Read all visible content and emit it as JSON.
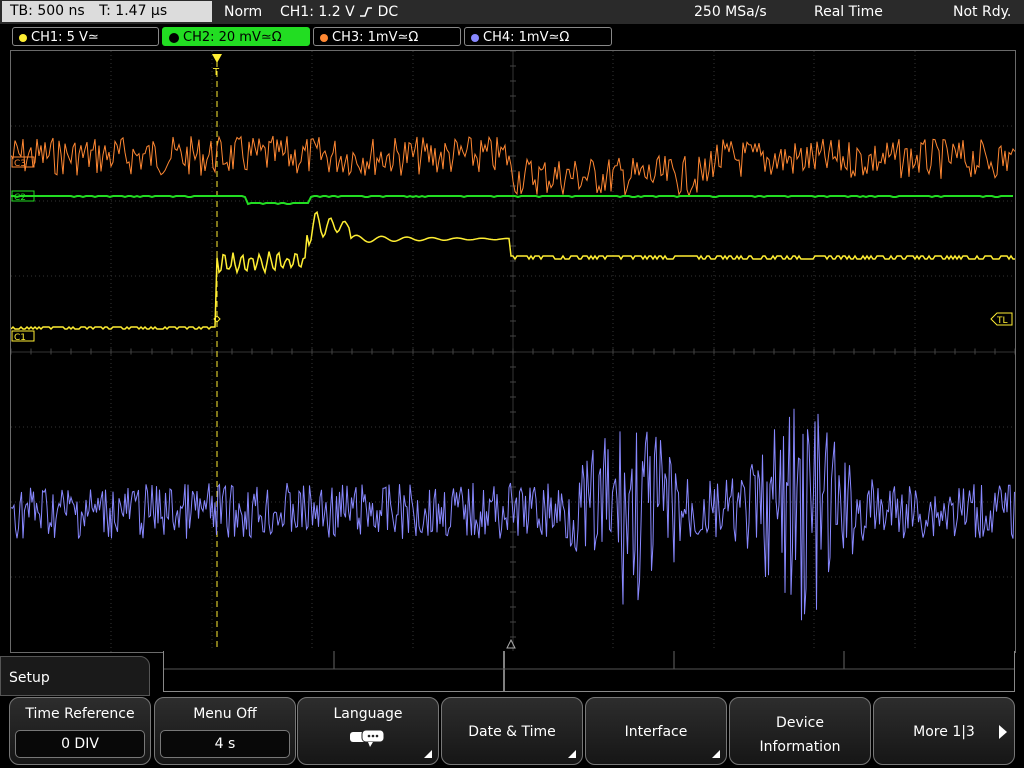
{
  "status": {
    "timebase": "TB: 500 ns",
    "trigger_time": "T: 1.47 µs",
    "mode": "Norm",
    "trigger_source": "CH1: 1.2 V",
    "trigger_coupling": "DC",
    "sample_rate": "250 MSa/s",
    "acquisition": "Real Time",
    "state": "Not Rdy."
  },
  "channels": [
    {
      "label": "CH1: 5 V≃",
      "color": "#ffee33"
    },
    {
      "label": "CH2: 20 mV≃Ω",
      "color": "#22dd22"
    },
    {
      "label": "CH3: 1mV≃Ω",
      "color": "#ff8833"
    },
    {
      "label": "CH4: 1mV≃Ω",
      "color": "#8888ff"
    }
  ],
  "markers": {
    "ch1": "C1",
    "ch2": "C2",
    "ch3": "C3",
    "trigger_level": "TL"
  },
  "menu": {
    "title": "Setup",
    "time_reference_label": "Time Reference",
    "time_reference_value": "0 DIV",
    "menu_off_label": "Menu Off",
    "menu_off_value": "4 s",
    "language_label": "Language",
    "date_time_label": "Date & Time",
    "interface_label": "Interface",
    "device_info_line1": "Device",
    "device_info_line2": "Information",
    "more_label": "More 1|3"
  }
}
